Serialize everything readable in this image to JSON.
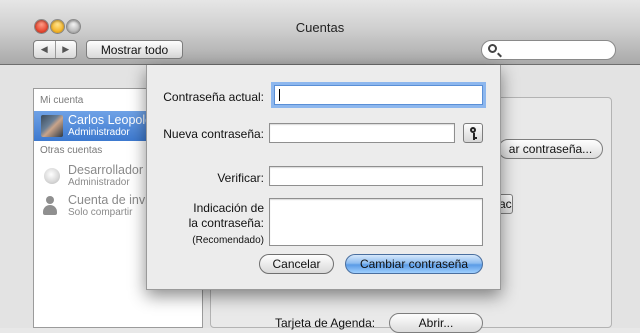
{
  "window": {
    "title": "Cuentas"
  },
  "toolbar": {
    "back_icon": "◀",
    "forward_icon": "▶",
    "show_all_label": "Mostrar todo",
    "search_placeholder": ""
  },
  "sidebar": {
    "my_account_header": "Mi cuenta",
    "other_accounts_header": "Otras cuentas",
    "accounts": [
      {
        "name": "Carlos Leopold",
        "role": "Administrador"
      },
      {
        "name": "Desarrollador",
        "role": "Administrador"
      },
      {
        "name": "Cuenta de invit",
        "role": "Solo compartir"
      }
    ]
  },
  "background": {
    "change_password_button": "ar contraseña...",
    "partial_button": "ac",
    "agenda_label": "Tarjeta de Agenda:",
    "open_button": "Abrir..."
  },
  "sheet": {
    "current_password_label": "Contraseña actual:",
    "new_password_label": "Nueva contraseña:",
    "verify_label": "Verificar:",
    "hint_label_line1": "Indicación de",
    "hint_label_line2": "la contraseña:",
    "hint_recommended": "(Recomendado)",
    "current_password_value": "",
    "new_password_value": "",
    "verify_value": "",
    "hint_value": "",
    "cancel_label": "Cancelar",
    "confirm_label": "Cambiar contraseña"
  }
}
